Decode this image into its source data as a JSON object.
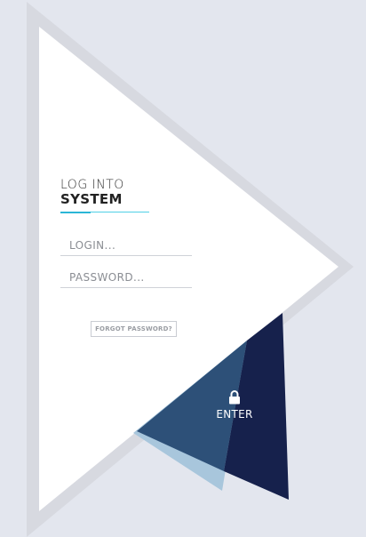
{
  "title": {
    "line1": "LOG INTO",
    "line2": "SYSTEM"
  },
  "form": {
    "login_placeholder": "LOGIN...",
    "password_placeholder": "PASSWORD...",
    "forgot_label": "FORGOT PASSWORD?",
    "enter_label": "ENTER"
  },
  "icons": {
    "lock": "lock-icon"
  },
  "colors": {
    "background": "#e3e6ee",
    "triangle_border": "#d7d9e0",
    "triangle_fill": "#ffffff",
    "accent_cyan": "#4fd0e6",
    "navy": "#16214c",
    "mid_blue": "#2d5078",
    "light_blue": "#a8c6dc"
  }
}
